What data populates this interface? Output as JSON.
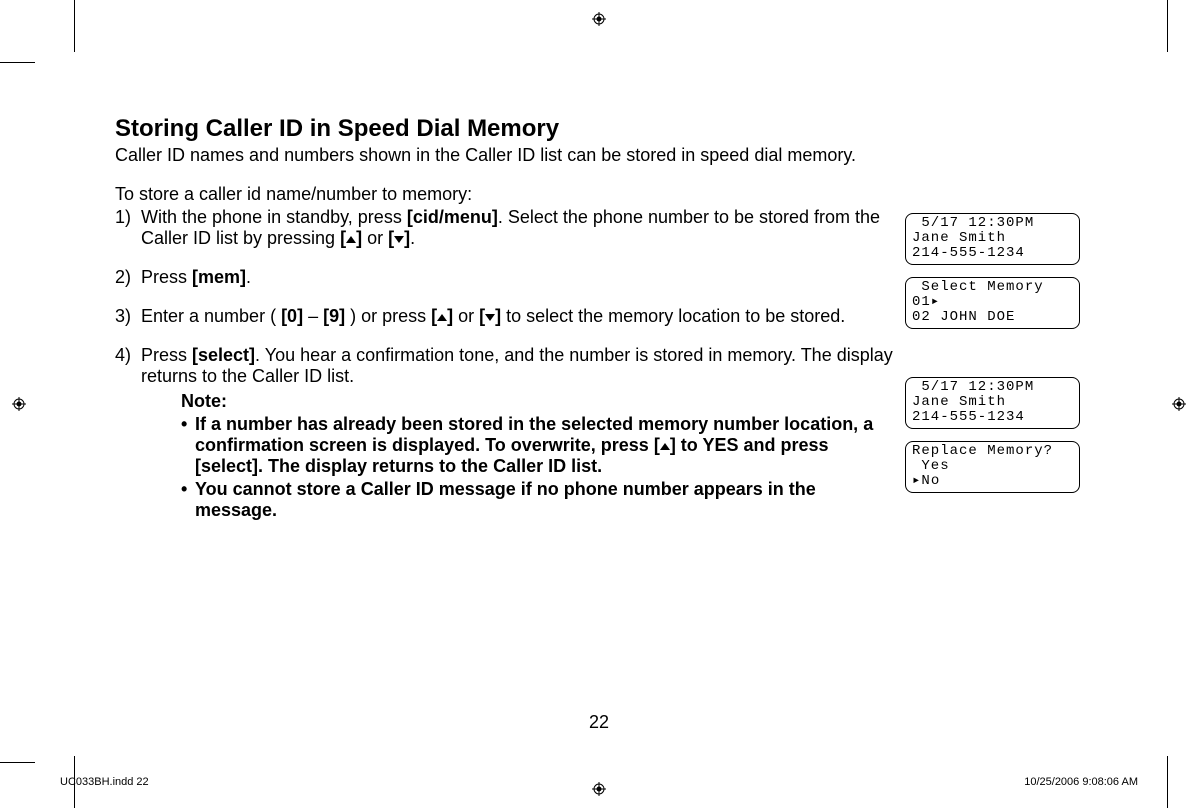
{
  "title": "Storing Caller ID in Speed Dial Memory",
  "intro": "Caller ID names and numbers shown in the Caller ID list can be stored in speed dial memory.",
  "lead": "To store a caller id name/number to memory:",
  "steps": [
    {
      "num": "1)",
      "pre": "With the phone in standby, press ",
      "key1": "[cid/menu]",
      "mid": ". Select the phone number to be stored from the Caller ID list by pressing ",
      "key2_open": "[",
      "key2_close": "]",
      "or": " or ",
      "key3_open": "[",
      "key3_close": "]",
      "end": "."
    },
    {
      "num": "2)",
      "pre": "Press ",
      "key1": "[mem]",
      "end": "."
    },
    {
      "num": "3)",
      "pre": "Enter a number ( ",
      "key1": "[0]",
      "dash": " – ",
      "key2": "[9]",
      "mid": " ) or press ",
      "key3_open": "[",
      "key3_close": "]",
      "or": " or ",
      "key4_open": "[",
      "key4_close": "]",
      "end": " to select the memory location to be stored."
    },
    {
      "num": "4)",
      "pre": "Press ",
      "key1": "[select]",
      "end": ". You hear a confirmation tone, and the number is stored in memory. The display returns to the Caller ID list."
    }
  ],
  "noteLabel": "Note:",
  "notes": [
    {
      "pre": "If a number has already been stored in the selected memory number location, a confirmation screen is displayed. To overwrite, press [",
      "post": "] to YES and press [select]. The display returns to the Caller ID list."
    },
    {
      "text": "You cannot store a Caller ID message if no phone number appears in the message."
    }
  ],
  "lcds": [
    " 5/17 12:30PM\nJane Smith\n214-555-1234",
    " Select Memory\n01▸\n02 JOHN DOE",
    " 5/17 12:30PM\nJane Smith\n214-555-1234",
    "Replace Memory?\n Yes\n▸No"
  ],
  "pageNumber": "22",
  "footerLeft": "UC033BH.indd   22",
  "footerRight": "10/25/2006   9:08:06 AM"
}
